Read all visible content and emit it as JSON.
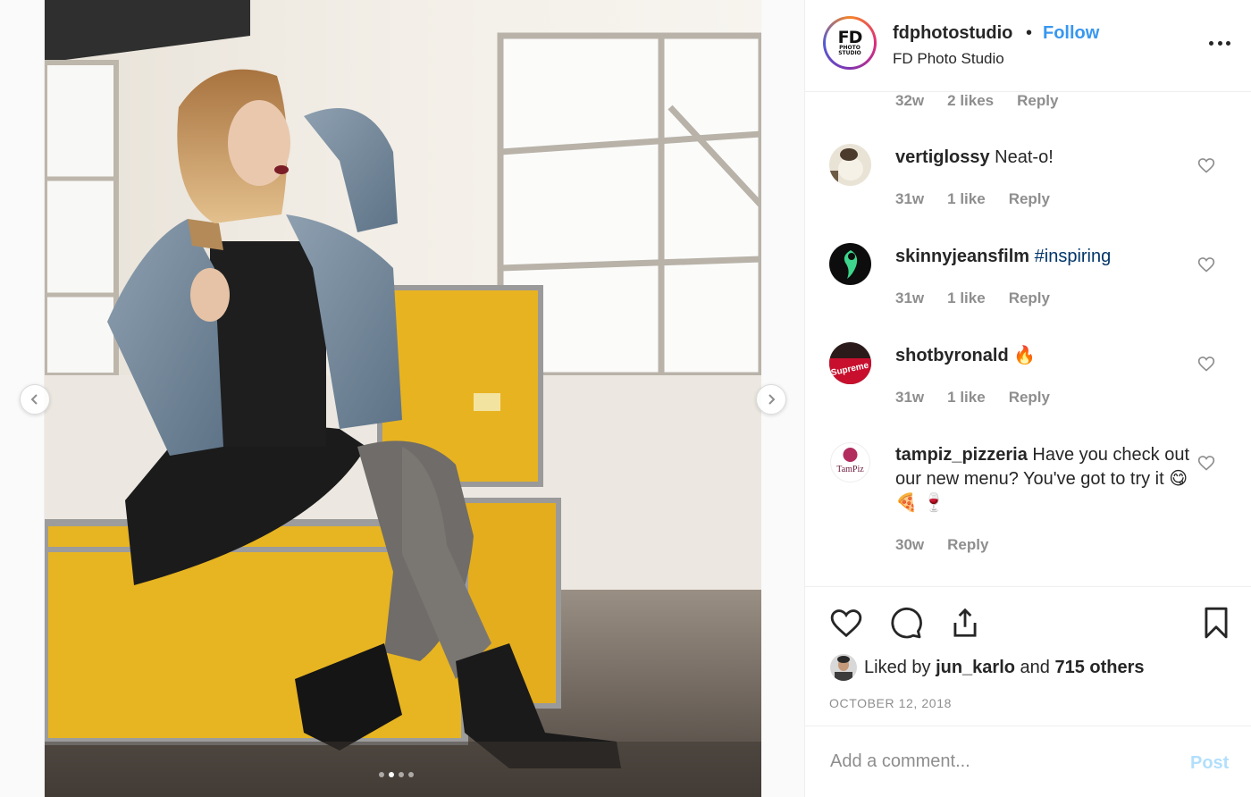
{
  "post": {
    "username": "fdphotostudio",
    "separator": "•",
    "follow_label": "Follow",
    "full_name": "FD Photo Studio",
    "avatar_text_main": "FD",
    "avatar_text_sub": "PHOTO STUDIO",
    "more_icon": "more-horizontal-icon"
  },
  "carousel": {
    "prev_icon": "chevron-left-icon",
    "next_icon": "chevron-right-icon",
    "slide_count": 4,
    "active_slide": 2
  },
  "first_meta": {
    "time": "32w",
    "likes": "2 likes",
    "reply": "Reply"
  },
  "comments": [
    {
      "user": "vertiglossy",
      "text": " Neat-o!",
      "time": "31w",
      "likes": "1 like",
      "reply": "Reply"
    },
    {
      "user": "skinnyjeansfilm",
      "text": " ",
      "tag": "#inspiring",
      "time": "31w",
      "likes": "1 like",
      "reply": "Reply"
    },
    {
      "user": "shotbyronald",
      "text": " 🔥",
      "time": "31w",
      "likes": "1 like",
      "reply": "Reply"
    },
    {
      "user": "tampiz_pizzeria",
      "text": " Have you check out our new menu? You've got to try it 😋 🍕 🍷",
      "time": "30w",
      "reply": "Reply"
    }
  ],
  "avatar_labels": {
    "shotbyronald": "Supreme",
    "tampiz": "TamPiz"
  },
  "actions": {
    "like_icon": "heart-icon",
    "comment_icon": "comment-icon",
    "share_icon": "share-icon",
    "save_icon": "bookmark-icon"
  },
  "likes": {
    "prefix": "Liked by ",
    "user": "jun_karlo",
    "and": " and ",
    "others": "715 others"
  },
  "date": "OCTOBER 12, 2018",
  "add_comment": {
    "placeholder": "Add a comment...",
    "post_label": "Post"
  },
  "colors": {
    "link": "#3897f0",
    "hashtag": "#003569",
    "muted": "#8e8e8e",
    "post_disabled": "#b2dffc",
    "heart_emoji": "#e0245e"
  }
}
